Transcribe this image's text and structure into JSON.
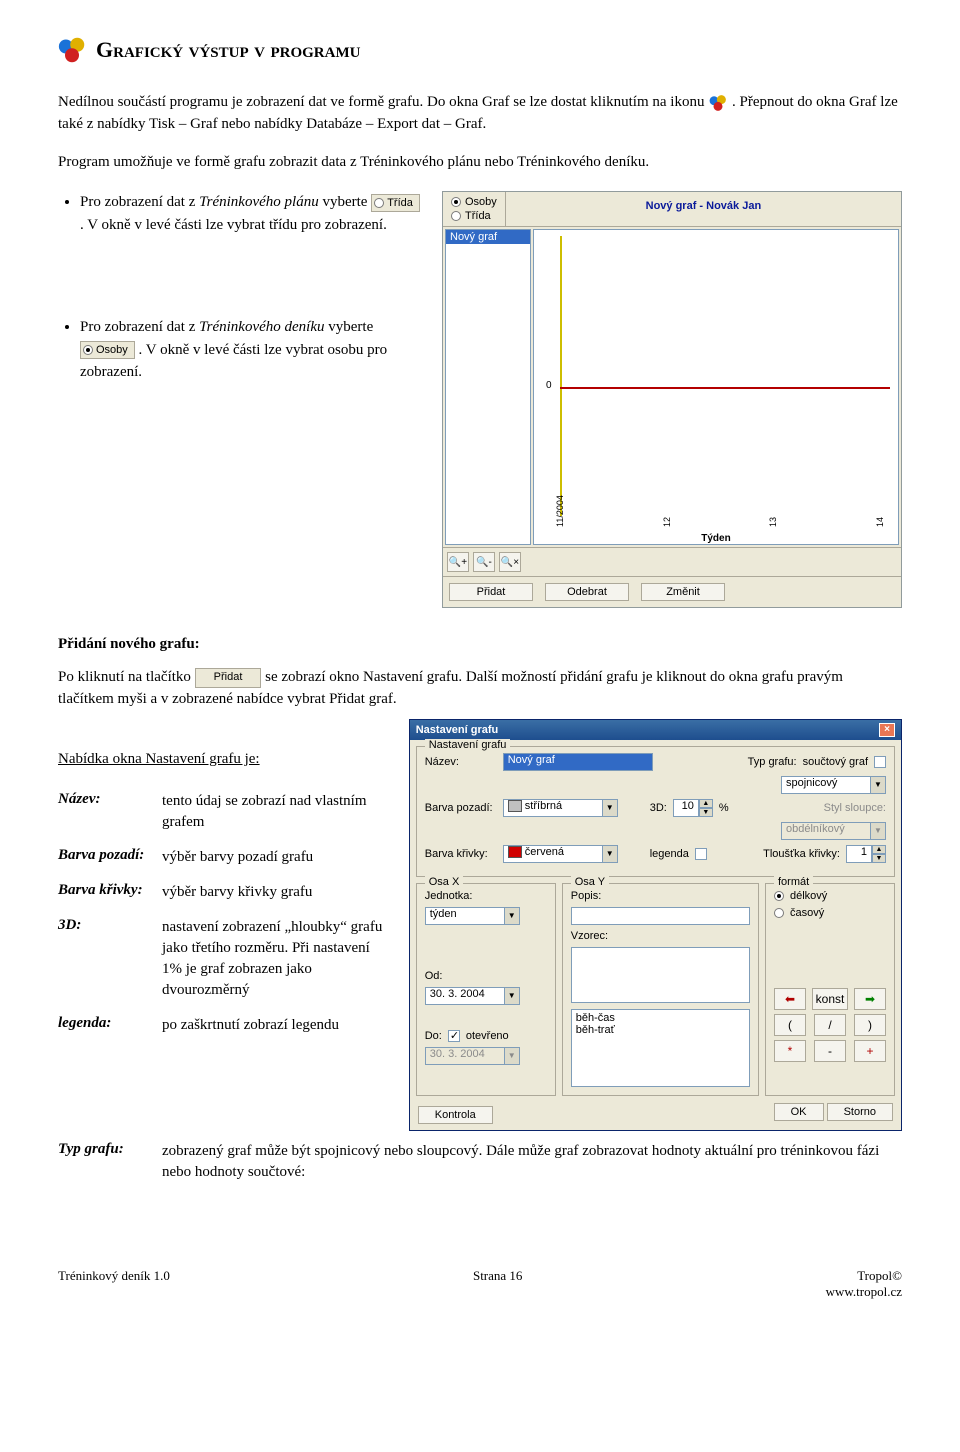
{
  "title": "Grafický výstup v programu",
  "intro1a": "Nedílnou součástí programu je zobrazení dat ve formě grafu. Do okna Graf se lze dostat kliknutím na ikonu ",
  "intro1b": ". Přepnout do okna Graf lze také z nabídky Tisk – Graf nebo nabídky Databáze – Export dat – Graf.",
  "intro2": "Program umožňuje ve formě grafu zobrazit data z Tréninkového plánu nebo Tréninkového deníku.",
  "bullets": {
    "b1a": "Pro zobrazení dat z ",
    "b1i": "Tréninkového plánu",
    "b1b": " vyberte ",
    "b1c": ". V okně v levé části lze vybrat třídu pro zobrazení.",
    "b2a": "Pro zobrazení dat z ",
    "b2i": "Tréninkového deníku",
    "b2b": " vyberte ",
    "b2c": ". V okně v levé části lze vybrat osobu pro zobrazení."
  },
  "inlineRadios": {
    "trida": "Třída",
    "osoby": "Osoby"
  },
  "grafwin": {
    "osoby": "Osoby",
    "trida": "Třída",
    "caption": "Nový graf - Novák Jan",
    "listSel": "Nový graf",
    "zero": "0",
    "xticks": [
      "11/2004",
      "12",
      "13",
      "14"
    ],
    "xlabel": "Týden",
    "btns": [
      "Přidat",
      "Odebrat",
      "Změnit"
    ]
  },
  "subheading": "Přidání nového grafu:",
  "addPara_a": "Po kliknutí na tlačítko ",
  "addPara_btn": "Přidat",
  "addPara_b": " se zobrazí okno Nastavení grafu. Další možností přidání grafu je kliknout do okna grafu pravým tlačítkem myši a v zobrazené nabídce vybrat Přidat graf.",
  "menuLine": "Nabídka okna Nastavení grafu je:",
  "defs": {
    "nazev": {
      "t": "Název:",
      "d": "tento údaj se zobrazí nad vlastním grafem"
    },
    "bpozadi": {
      "t": "Barva pozadí:",
      "d": "výběr barvy pozadí grafu"
    },
    "bkrivky": {
      "t": "Barva křivky:",
      "d": "výběr barvy křivky grafu"
    },
    "d3": {
      "t": "3D:",
      "d": "nastavení zobrazení „hloubky“ grafu jako třetího rozměru. Při nastavení 1% je graf zobrazen jako dvourozměrný"
    },
    "legenda": {
      "t": "legenda:",
      "d": "po zaškrtnutí zobrazí legendu"
    },
    "typ": {
      "t": "Typ grafu:",
      "d": "zobrazený graf může být spojnicový nebo sloupcový. Dále může graf zobrazovat hodnoty aktuální pro tréninkovou fázi nebo hodnoty součtové:"
    }
  },
  "dlg": {
    "title": "Nastavení grafu",
    "fs1": "Nastavení grafu",
    "nazev": "Název:",
    "nazev_val": "Nový graf",
    "bpozadi": "Barva pozadí:",
    "bpozadi_val": "stříbrná",
    "bkrivky": "Barva křivky:",
    "bkrivky_val": "červená",
    "typ": "Typ grafu:",
    "souct": "součtový graf",
    "typ_val": "spojnicový",
    "styl": "Styl sloupce:",
    "styl_val": "obdélníkový",
    "d3": "3D:",
    "d3_val": "10",
    "pct": "%",
    "legenda": "legenda",
    "tloust": "Tloušťka křivky:",
    "tloust_val": "1",
    "osax": "Osa X",
    "jednotka": "Jednotka:",
    "jednotka_val": "týden",
    "od": "Od:",
    "od_val": "30. 3. 2004",
    "do": "Do:",
    "do_val": "30. 3. 2004",
    "otevreno": "otevřeno",
    "osay": "Osa Y",
    "popis": "Popis:",
    "vzorec": "Vzorec:",
    "listitems": [
      "běh-čas",
      "běh-trať"
    ],
    "format": "formát",
    "delkovy": "délkový",
    "casovy": "časový",
    "btns_arrow_l": "⬅",
    "btns_konst": "konst",
    "btns_arrow_r": "➡",
    "sym_lp": "(",
    "sym_sl": "/",
    "sym_rp": ")",
    "sym_mul": "*",
    "sym_min": "-",
    "sym_plus": "+",
    "kontrola": "Kontrola",
    "ok": "OK",
    "storno": "Storno"
  },
  "footer": {
    "left": "Tréninkový deník 1.0",
    "center": "Strana 16",
    "r1": "Tropol©",
    "r2": "www.tropol.cz"
  }
}
